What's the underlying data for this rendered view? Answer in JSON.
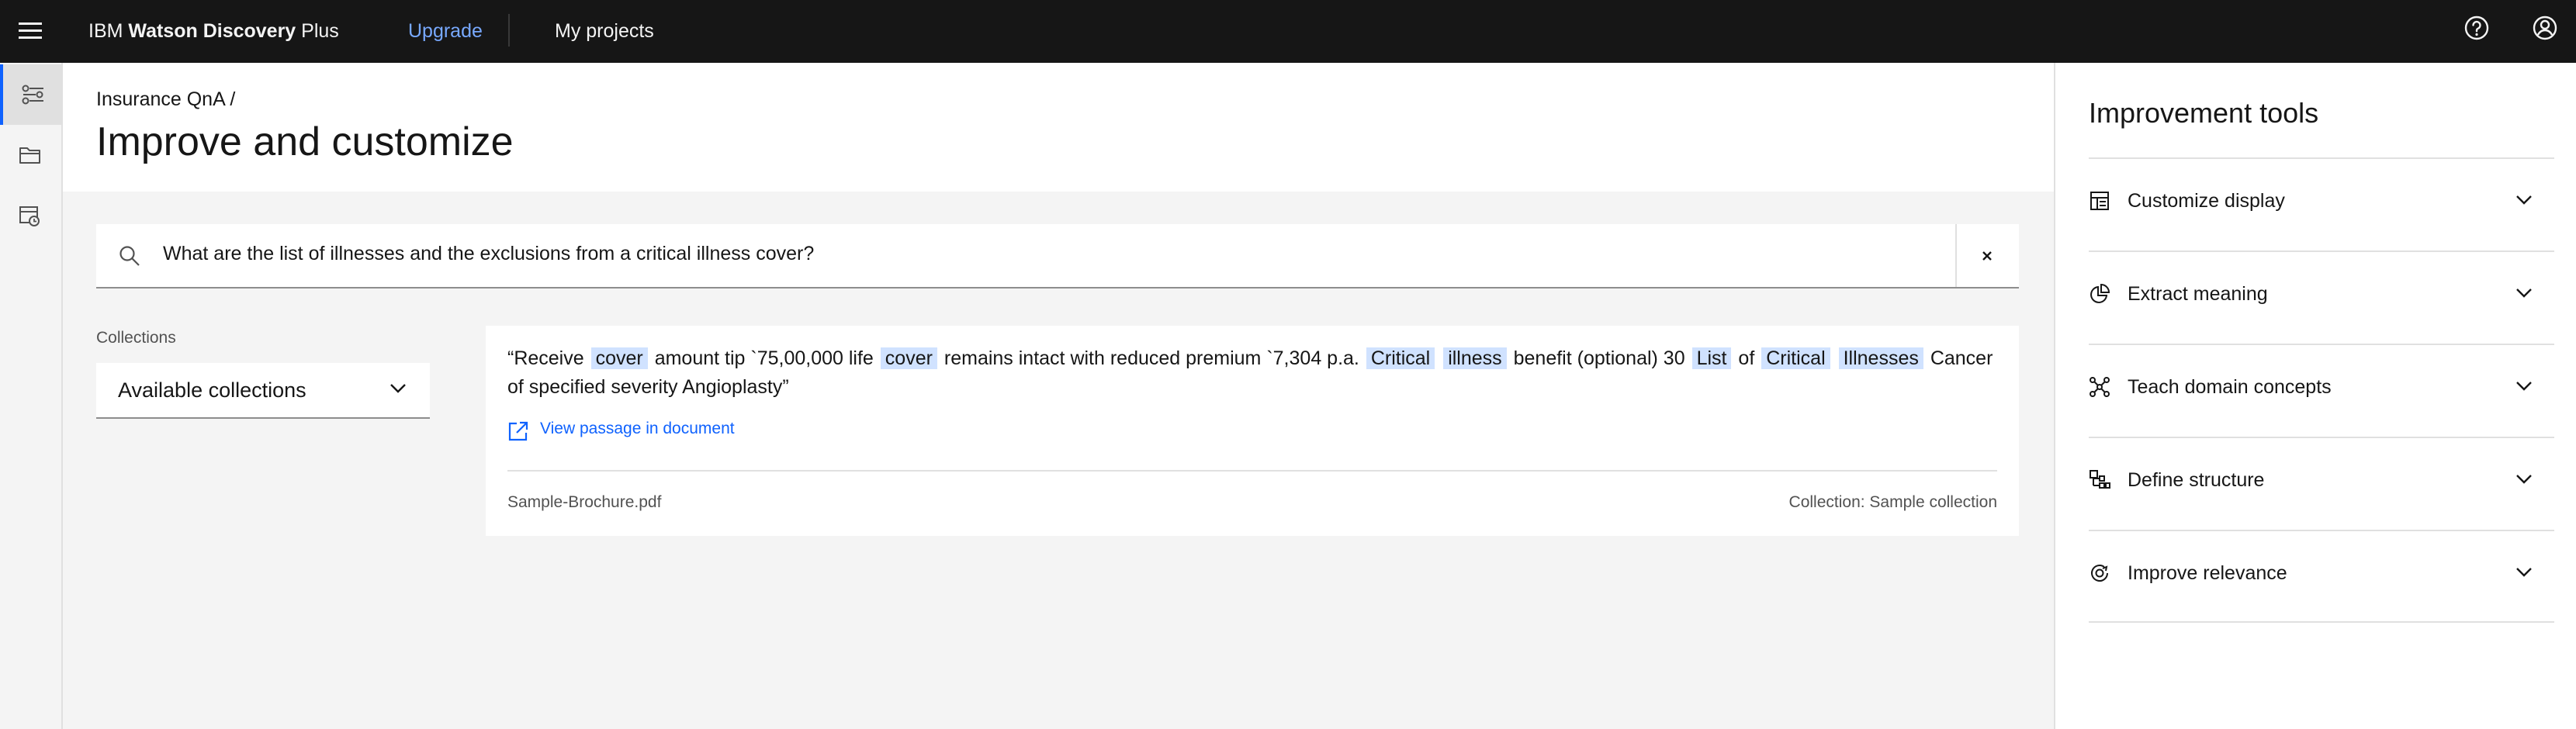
{
  "header": {
    "brand_prefix": "IBM",
    "brand_bold": "Watson Discovery",
    "brand_suffix": "Plus",
    "upgrade_label": "Upgrade",
    "my_projects_label": "My projects"
  },
  "breadcrumb": "Insurance QnA  /",
  "page_title": "Improve and customize",
  "search": {
    "query": "What are the list of illnesses and the exclusions from a critical illness cover?"
  },
  "collections": {
    "label": "Collections",
    "selected": "Available collections"
  },
  "result": {
    "passage_segments": [
      {
        "text": "“Receive",
        "hl": false
      },
      {
        "text": "cover",
        "hl": true
      },
      {
        "text": "amount tip `75,00,000 life",
        "hl": false
      },
      {
        "text": "cover",
        "hl": true
      },
      {
        "text": "remains intact with reduced premium `7,304 p.a.",
        "hl": false
      },
      {
        "text": "Critical",
        "hl": true
      },
      {
        "text": "illness",
        "hl": true
      },
      {
        "text": "benefit (optional) 30",
        "hl": false
      },
      {
        "text": "List",
        "hl": true
      },
      {
        "text": "of",
        "hl": false
      },
      {
        "text": "Critical",
        "hl": true
      },
      {
        "text": "Illnesses",
        "hl": true
      },
      {
        "text": "Cancer of specified severity Angioplasty”",
        "hl": false
      }
    ],
    "view_link": "View passage in document",
    "filename": "Sample-Brochure.pdf",
    "collection": "Collection: Sample collection"
  },
  "right_panel": {
    "title": "Improvement tools",
    "items": [
      {
        "label": "Customize display",
        "icon": "layout-icon"
      },
      {
        "label": "Extract meaning",
        "icon": "chart-pie-icon"
      },
      {
        "label": "Teach domain concepts",
        "icon": "network-icon"
      },
      {
        "label": "Define structure",
        "icon": "grid-structure-icon"
      },
      {
        "label": "Improve relevance",
        "icon": "target-relevance-icon"
      }
    ]
  },
  "colors": {
    "header_bg": "#161616",
    "accent": "#0f62fe",
    "upgrade_link": "#78a9ff",
    "highlight": "#d0e2ff"
  }
}
